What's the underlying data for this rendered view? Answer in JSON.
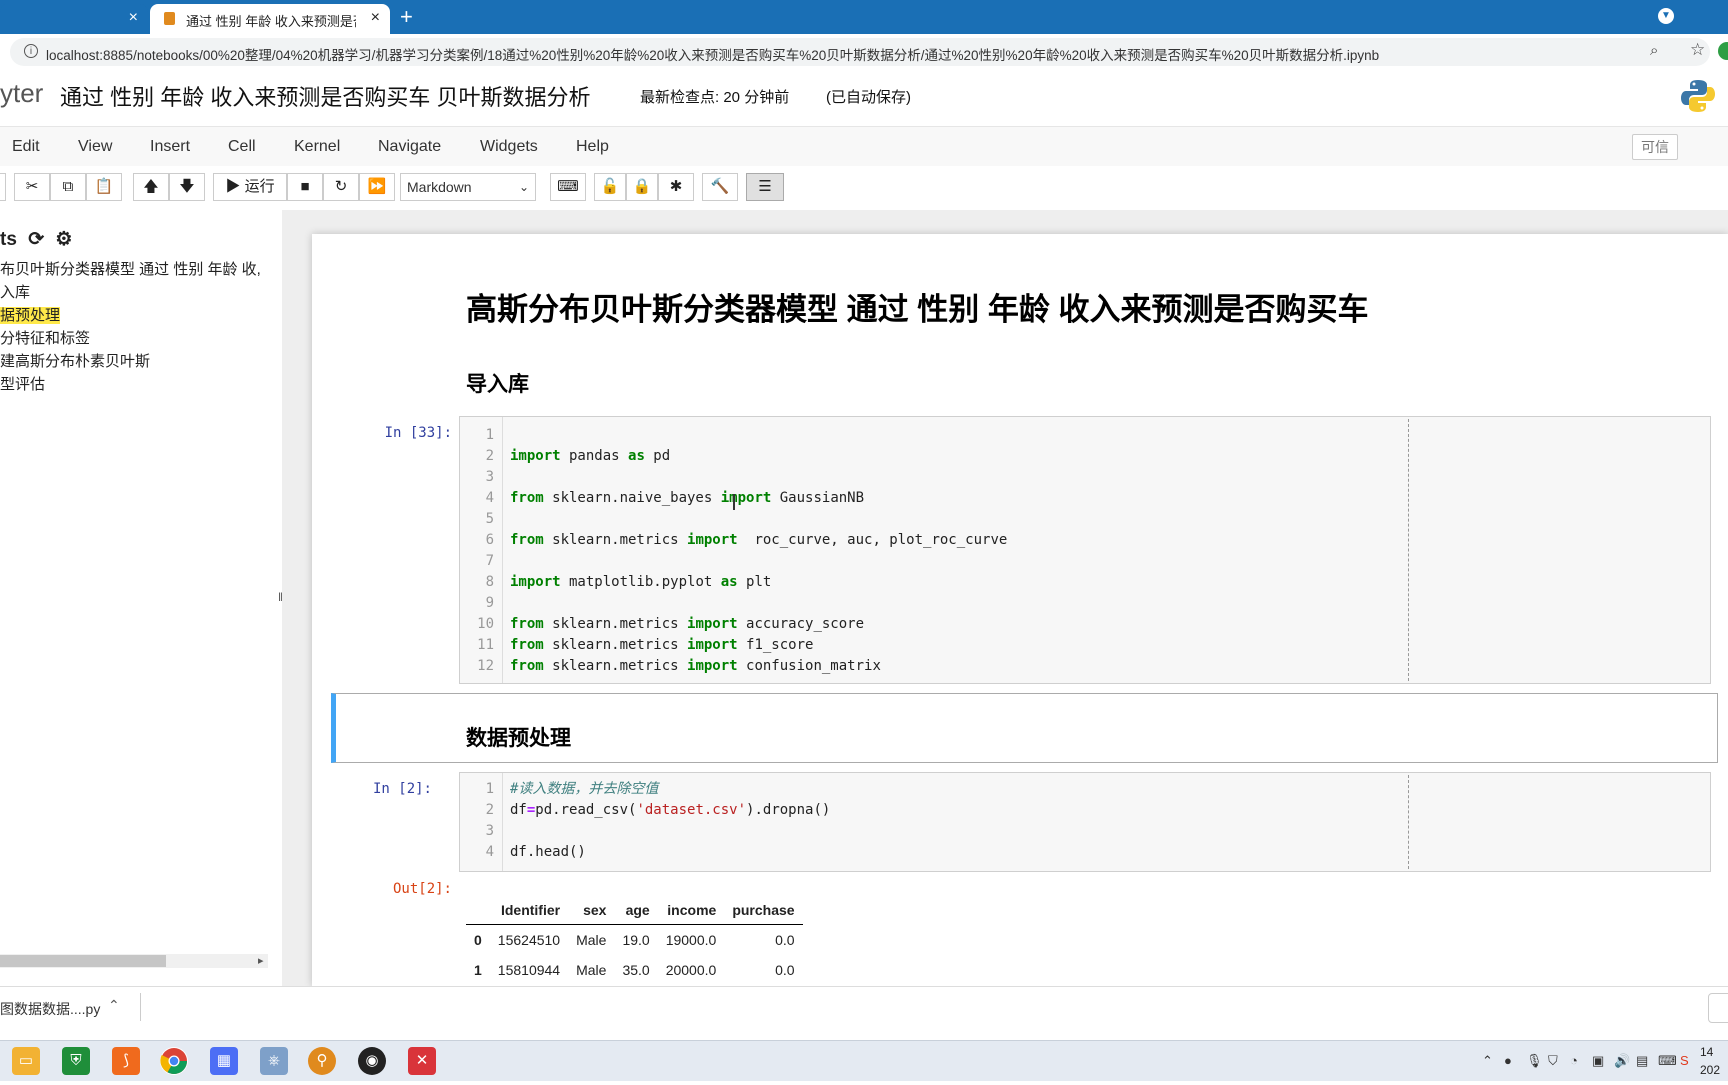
{
  "browser": {
    "tab1_close": "×",
    "tab2_title": "通过 性别 年龄 收入来预测是否购买车",
    "tab2_close": "×",
    "new_tab": "+",
    "url": "localhost:8885/notebooks/00%20整理/04%20机器学习/机器学习分类案例/18通过%20性别%20年龄%20收入来预测是否购买车%20贝叶斯数据分析/通过%20性别%20年龄%20收入来预测是否购买车%20贝叶斯数据分析.ipynb"
  },
  "header": {
    "logo_text": "yter",
    "notebook_title": "通过 性别 年龄 收入来预测是否购买车 贝叶斯数据分析",
    "checkpoint": "最新检查点: 20 分钟前",
    "autosave": "(已自动保存)"
  },
  "menubar": {
    "items": [
      "Edit",
      "View",
      "Insert",
      "Cell",
      "Kernel",
      "Navigate",
      "Widgets",
      "Help"
    ],
    "trusted": "可信"
  },
  "toolbar": {
    "run_label": "运行",
    "cell_type": "Markdown"
  },
  "toc": {
    "title": "ts",
    "items": [
      "布贝叶斯分类器模型 通过 性别 年龄 收,",
      "入库",
      "据预处理",
      "分特征和标签",
      "建高斯分布朴素贝叶斯",
      "型评估"
    ]
  },
  "notebook": {
    "h1": "高斯分布贝叶斯分类器模型 通过 性别 年龄 收入来预测是否购买车",
    "h2_import": "导入库",
    "h2_preprocess": "数据预处理",
    "cell1_prompt": "In  [33]:",
    "cell2_prompt": "In  [2]:",
    "out2_prompt": "Out[2]:",
    "cell1_line_numbers": [
      "1",
      "2",
      "3",
      "4",
      "5",
      "6",
      "7",
      "8",
      "9",
      "10",
      "11",
      "12"
    ],
    "cell2_line_numbers": [
      "1",
      "2",
      "3",
      "4"
    ]
  },
  "dataframe": {
    "columns": [
      "Identifier",
      "sex",
      "age",
      "income",
      "purchase"
    ],
    "rows": [
      {
        "index": "0",
        "Identifier": "15624510",
        "sex": "Male",
        "age": "19.0",
        "income": "19000.0",
        "purchase": "0.0"
      },
      {
        "index": "1",
        "Identifier": "15810944",
        "sex": "Male",
        "age": "35.0",
        "income": "20000.0",
        "purchase": "0.0"
      }
    ]
  },
  "downloads": {
    "file": "图数据数据....py"
  },
  "taskbar": {
    "clock_time": "14",
    "clock_date": "202"
  }
}
